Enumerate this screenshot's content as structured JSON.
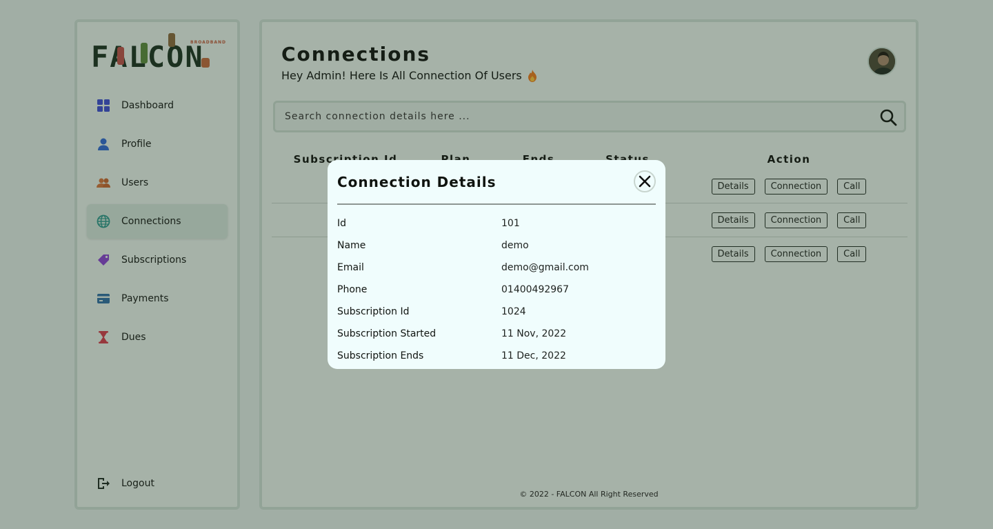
{
  "brand": {
    "name": "FALCON",
    "tagline": "BROADBAND"
  },
  "sidebar": {
    "items": [
      {
        "label": "Dashboard",
        "icon": "dashboard-grid-icon",
        "color": "#3a4bd8"
      },
      {
        "label": "Profile",
        "icon": "user-icon",
        "color": "#2c6ad8"
      },
      {
        "label": "Users",
        "icon": "users-icon",
        "color": "#d6743a"
      },
      {
        "label": "Connections",
        "icon": "globe-icon",
        "color": "#2a9a8f",
        "active": true
      },
      {
        "label": "Subscriptions",
        "icon": "tags-icon",
        "color": "#8a3fd6"
      },
      {
        "label": "Payments",
        "icon": "card-icon",
        "color": "#2c6fa8"
      },
      {
        "label": "Dues",
        "icon": "hourglass-icon",
        "color": "#d63a4b"
      }
    ],
    "logout_label": "Logout"
  },
  "header": {
    "title": "Connections",
    "subtitle": "Hey Admin! Here Is All Connection Of Users"
  },
  "search": {
    "placeholder": "Search connection details here ..."
  },
  "table": {
    "columns": [
      "Subscription Id",
      "Plan",
      "Ends",
      "Status",
      "Action"
    ],
    "row_actions": [
      "Details",
      "Connection",
      "Call"
    ],
    "rows": [
      {
        "subscription_id": "",
        "plan": "",
        "ends": "",
        "status": ""
      },
      {
        "subscription_id": "",
        "plan": "",
        "ends": "",
        "status": ""
      },
      {
        "subscription_id": "",
        "plan": "",
        "ends": "",
        "status": ""
      }
    ]
  },
  "footer": {
    "text": "© 2022 - FALCON All Right Reserved"
  },
  "modal": {
    "title": "Connection Details",
    "details": [
      {
        "label": "Id",
        "value": "101"
      },
      {
        "label": "Name",
        "value": "demo"
      },
      {
        "label": "Email",
        "value": "demo@gmail.com"
      },
      {
        "label": "Phone",
        "value": "01400492967"
      },
      {
        "label": "Subscription Id",
        "value": "1024"
      },
      {
        "label": "Subscription Started",
        "value": "11 Nov, 2022"
      },
      {
        "label": "Subscription Ends",
        "value": "11 Dec, 2022"
      }
    ]
  }
}
